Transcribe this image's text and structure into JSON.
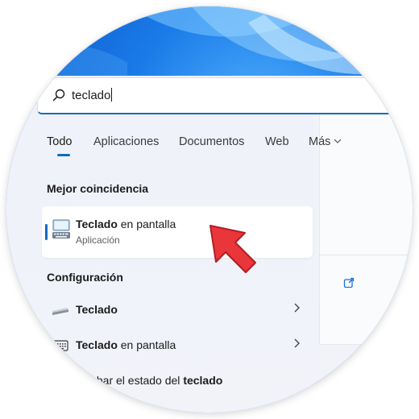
{
  "search": {
    "query": "teclado"
  },
  "tabs": [
    {
      "label": "Todo",
      "active": true
    },
    {
      "label": "Aplicaciones",
      "active": false
    },
    {
      "label": "Documentos",
      "active": false
    },
    {
      "label": "Web",
      "active": false
    },
    {
      "label": "Más",
      "active": false,
      "dropdown": true
    }
  ],
  "best_match": {
    "heading": "Mejor coincidencia",
    "title_bold": "Teclado",
    "title_rest": " en pantalla",
    "subtitle": "Aplicación",
    "icon": "on-screen-keyboard-icon"
  },
  "settings": {
    "heading": "Configuración",
    "items": [
      {
        "bold": "Teclado",
        "rest": "",
        "icon": "keyboard-icon"
      },
      {
        "bold": "Teclado",
        "rest": " en pantalla",
        "icon": "keyboard-icon"
      },
      {
        "prefix": "mprobar el estado del ",
        "bold": "teclado",
        "icon": "keyboard-icon"
      }
    ]
  },
  "colors": {
    "accent": "#0f6cbd",
    "pointer": "#e8363b"
  }
}
